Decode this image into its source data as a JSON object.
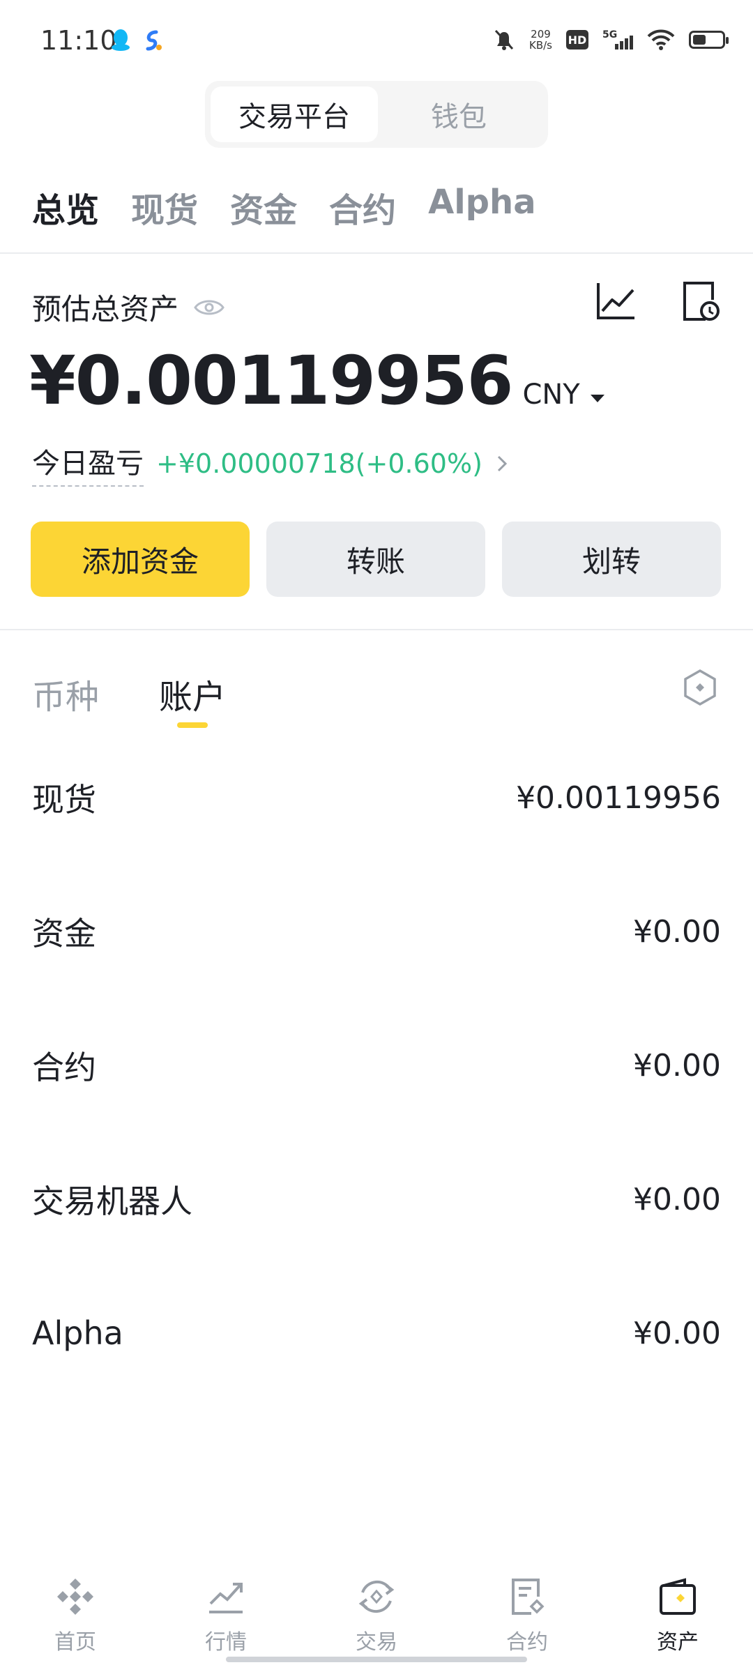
{
  "status_bar": {
    "time": "11:10",
    "net_speed_value": "209",
    "net_speed_unit": "KB/s",
    "hd_label": "HD",
    "network_label": "5G"
  },
  "platform_toggle": {
    "exchange": "交易平台",
    "wallet": "钱包"
  },
  "top_tabs": [
    "总览",
    "现货",
    "资金",
    "合约",
    "Alpha"
  ],
  "balance": {
    "label": "预估总资产",
    "amount": "¥0.00119956",
    "currency": "CNY",
    "pnl_label": "今日盈亏",
    "pnl_value": "+¥0.00000718(+0.60%)"
  },
  "actions": {
    "add_funds": "添加资金",
    "transfer": "转账",
    "internal_transfer": "划转"
  },
  "sub_tabs": {
    "coins": "币种",
    "accounts": "账户"
  },
  "accounts": [
    {
      "name": "现货",
      "value": "¥0.00119956"
    },
    {
      "name": "资金",
      "value": "¥0.00"
    },
    {
      "name": "合约",
      "value": "¥0.00"
    },
    {
      "name": "交易机器人",
      "value": "¥0.00"
    },
    {
      "name": "Alpha",
      "value": "¥0.00"
    }
  ],
  "bottom_nav": [
    "首页",
    "行情",
    "交易",
    "合约",
    "资产"
  ],
  "colors": {
    "accent_yellow": "#fcd535",
    "positive_green": "#2ebd85",
    "text_primary": "#1e2026",
    "text_secondary": "#9aa0a8"
  }
}
